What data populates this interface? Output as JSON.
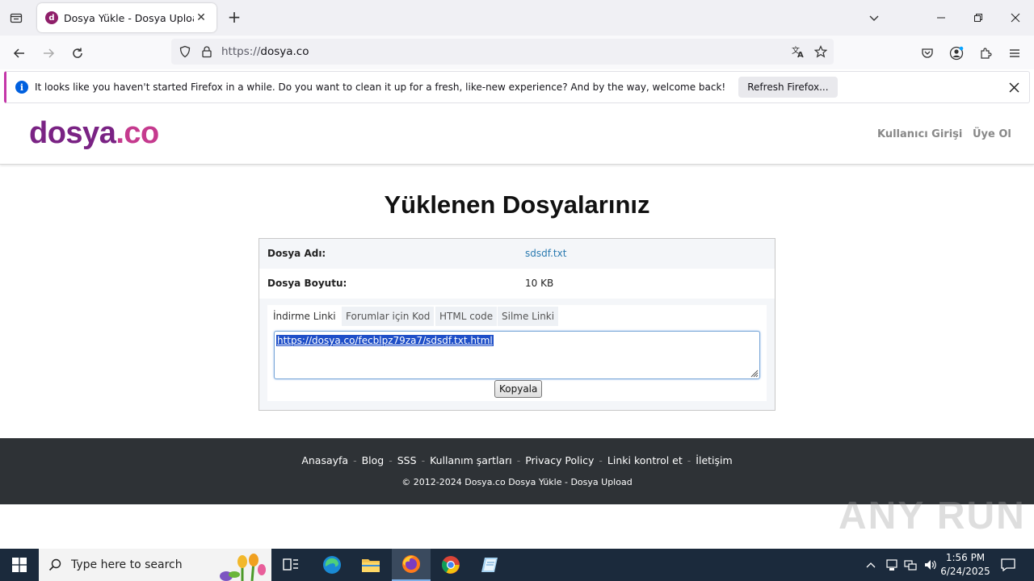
{
  "browser": {
    "tab_title": "Dosya Yükle - Dosya Upload",
    "url_scheme": "https://",
    "url_host": "dosya.co",
    "infobar_text": "It looks like you haven't started Firefox in a while. Do you want to clean it up for a fresh, like-new experience? And by the way, welcome back!",
    "infobar_button": "Refresh Firefox..."
  },
  "site": {
    "logo_main": "dosya",
    "logo_dot": ".co",
    "login_link": "Kullanıcı Girişi",
    "signup_link": "Üye Ol",
    "page_title": "Yüklenen Dosyalarınız"
  },
  "file": {
    "name_label": "Dosya Adı:",
    "name_value": "sdsdf.txt",
    "size_label": "Dosya Boyutu:",
    "size_value": "10 KB"
  },
  "link_tabs": [
    "İndirme Linki",
    "Forumlar için Kod",
    "HTML code",
    "Silme Linki"
  ],
  "link_value": "https://dosya.co/fecblpz79za7/sdsdf.txt.html",
  "copy_button": "Kopyala",
  "footer": {
    "links": [
      "Anasayfa",
      "Blog",
      "SSS",
      "Kullanım şartları",
      "Privacy Policy",
      "Linki kontrol et",
      "İletişim"
    ],
    "copyright": "© 2012-2024 Dosya.co Dosya Yükle - Dosya Upload"
  },
  "watermark": "ANY RUN",
  "taskbar": {
    "search_placeholder": "Type here to search",
    "time": "1:56 PM",
    "date": "6/24/2025"
  },
  "colors": {
    "brand": "#7a2384",
    "brand_accent": "#c53a8e",
    "footer_bg": "#2e3236",
    "link": "#2a7ab0",
    "taskbar_bg": "#1b2a3c"
  }
}
